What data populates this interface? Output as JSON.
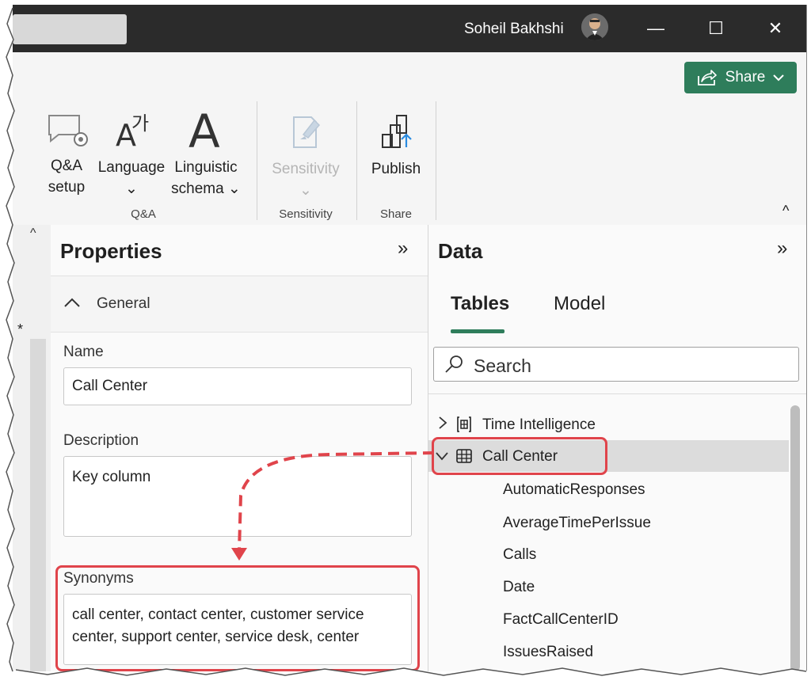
{
  "titlebar": {
    "user_name": "Soheil Bakhshi",
    "controls": [
      "—",
      "☐",
      "✕"
    ]
  },
  "ribbon": {
    "share_label": "Share",
    "buttons": {
      "qa_setup": [
        "Q&A",
        "setup"
      ],
      "language": [
        "Language",
        "⌄"
      ],
      "linguistic": [
        "Linguistic",
        "schema ⌄"
      ],
      "sensitivity": [
        "Sensitivity",
        "⌄"
      ],
      "publish": [
        "Publish"
      ]
    },
    "groups": [
      "Q&A",
      "Sensitivity",
      "Share"
    ],
    "collapse_glyph": "^"
  },
  "properties": {
    "title": "Properties",
    "expand_glyph": "»",
    "section_label": "General",
    "name_label": "Name",
    "name_value": "Call Center",
    "description_label": "Description",
    "description_value": "Key column",
    "synonyms_label": "Synonyms",
    "synonyms_value": "call center, contact center, customer service center, support center, service desk, center"
  },
  "data_pane": {
    "title": "Data",
    "expand_glyph": "»",
    "tabs": [
      "Tables",
      "Model"
    ],
    "active_tab": "Tables",
    "search_placeholder": "Search",
    "tables": [
      {
        "label": "Time Intelligence",
        "expanded": false
      },
      {
        "label": "Call Center",
        "expanded": true,
        "highlighted": true
      }
    ],
    "fields": [
      "AutomaticResponses",
      "AverageTimePerIssue",
      "Calls",
      "Date",
      "FactCallCenterID",
      "IssuesRaised"
    ]
  },
  "colors": {
    "accent": "#2e7d5b",
    "highlight": "#e0444b",
    "titlebar": "#2b2b2b"
  }
}
